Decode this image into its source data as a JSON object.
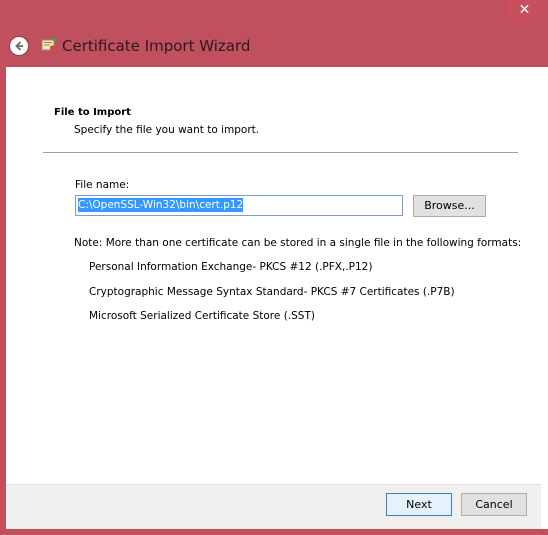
{
  "window": {
    "title": "Certificate Import Wizard",
    "close_label": "✕",
    "frame_color": "#c0505e"
  },
  "page": {
    "heading": "File to Import",
    "subheading": "Specify the file you want to import."
  },
  "file": {
    "label": "File name:",
    "value": "C:\\OpenSSL-Win32\\bin\\cert.p12",
    "browse_label": "Browse..."
  },
  "note": {
    "text": "Note:  More than one certificate can be stored in a single file in the following formats:",
    "formats": [
      "Personal Information Exchange- PKCS #12 (.PFX,.P12)",
      "Cryptographic Message Syntax Standard- PKCS #7 Certificates (.P7B)",
      "Microsoft Serialized Certificate Store (.SST)"
    ]
  },
  "footer": {
    "next_label": "Next",
    "cancel_label": "Cancel"
  },
  "icons": {
    "back": "back-arrow-icon",
    "wizard": "certificate-wizard-icon",
    "close": "close-icon"
  }
}
